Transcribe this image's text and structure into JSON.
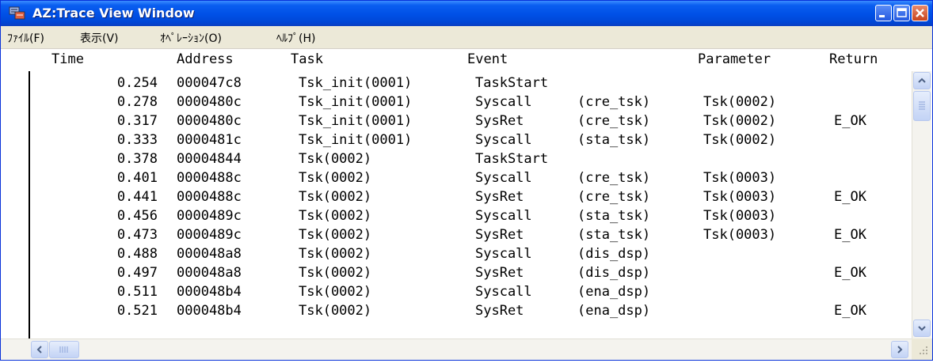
{
  "window": {
    "title": "AZ:Trace View Window",
    "accent": "#0054e3",
    "icons": {
      "app": "trace-view-icon",
      "minimize": "minimize-icon",
      "maximize": "maximize-icon",
      "close": "close-icon"
    }
  },
  "menu": {
    "items": [
      "ﾌｧｲﾙ(F)",
      "表示(V)",
      "ｵﾍﾟﾚｰｼｮﾝ(O)",
      "ﾍﾙﾌﾟ(H)"
    ]
  },
  "table": {
    "headers": [
      "Time",
      "Address",
      "Task",
      "Event",
      "Parameter",
      "Return"
    ],
    "rows": [
      [
        "0.254",
        "000047c8",
        "Tsk_init(0001)",
        "TaskStart",
        "",
        "",
        ""
      ],
      [
        "0.278",
        "0000480c",
        "Tsk_init(0001)",
        "Syscall",
        "(cre_tsk)",
        "Tsk(0002)",
        ""
      ],
      [
        "0.317",
        "0000480c",
        "Tsk_init(0001)",
        "SysRet",
        "(cre_tsk)",
        "Tsk(0002)",
        "E_OK"
      ],
      [
        "0.333",
        "0000481c",
        "Tsk_init(0001)",
        "Syscall",
        "(sta_tsk)",
        "Tsk(0002)",
        ""
      ],
      [
        "0.378",
        "00004844",
        "Tsk(0002)",
        "TaskStart",
        "",
        "",
        ""
      ],
      [
        "0.401",
        "0000488c",
        "Tsk(0002)",
        "Syscall",
        "(cre_tsk)",
        "Tsk(0003)",
        ""
      ],
      [
        "0.441",
        "0000488c",
        "Tsk(0002)",
        "SysRet",
        "(cre_tsk)",
        "Tsk(0003)",
        "E_OK"
      ],
      [
        "0.456",
        "0000489c",
        "Tsk(0002)",
        "Syscall",
        "(sta_tsk)",
        "Tsk(0003)",
        ""
      ],
      [
        "0.473",
        "0000489c",
        "Tsk(0002)",
        "SysRet",
        "(sta_tsk)",
        "Tsk(0003)",
        "E_OK"
      ],
      [
        "0.488",
        "000048a8",
        "Tsk(0002)",
        "Syscall",
        "(dis_dsp)",
        "",
        ""
      ],
      [
        "0.497",
        "000048a8",
        "Tsk(0002)",
        "SysRet",
        "(dis_dsp)",
        "",
        "E_OK"
      ],
      [
        "0.511",
        "000048b4",
        "Tsk(0002)",
        "Syscall",
        "(ena_dsp)",
        "",
        ""
      ],
      [
        "0.521",
        "000048b4",
        "Tsk(0002)",
        "SysRet",
        "(ena_dsp)",
        "",
        "E_OK"
      ]
    ]
  },
  "scrollbars": {
    "icons": {
      "up": "scroll-up-icon",
      "down": "scroll-down-icon",
      "left": "scroll-left-icon",
      "right": "scroll-right-icon",
      "grip": "resize-grip-icon"
    }
  }
}
